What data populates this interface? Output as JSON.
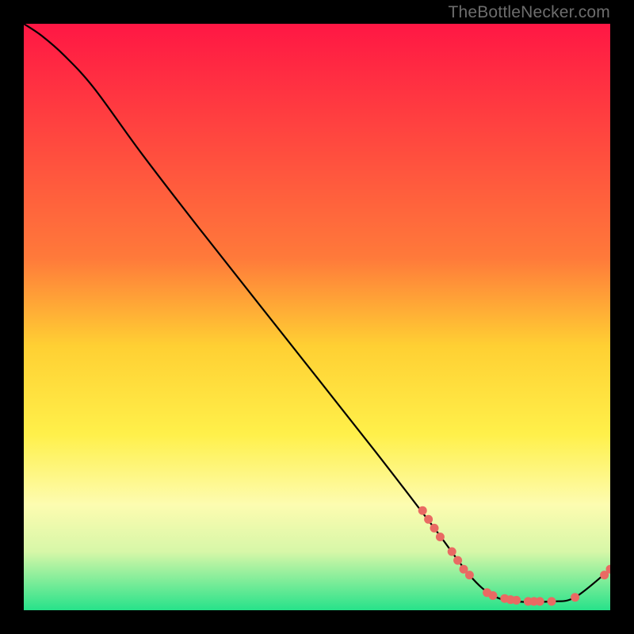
{
  "watermark": "TheBottleNecker.com",
  "chart_data": {
    "type": "line",
    "title": "",
    "xlabel": "",
    "ylabel": "",
    "xlim": [
      0,
      100
    ],
    "ylim": [
      0,
      100
    ],
    "gradient_stops": [
      {
        "offset": 0,
        "color": "#ff1744"
      },
      {
        "offset": 40,
        "color": "#ff7a3a"
      },
      {
        "offset": 55,
        "color": "#ffd033"
      },
      {
        "offset": 70,
        "color": "#fff04a"
      },
      {
        "offset": 82,
        "color": "#fdfcb0"
      },
      {
        "offset": 90,
        "color": "#d7f7a8"
      },
      {
        "offset": 100,
        "color": "#27e28a"
      }
    ],
    "curve": [
      {
        "x": 0,
        "y": 100
      },
      {
        "x": 3,
        "y": 98
      },
      {
        "x": 7,
        "y": 94.5
      },
      {
        "x": 12,
        "y": 89
      },
      {
        "x": 20,
        "y": 78
      },
      {
        "x": 30,
        "y": 65
      },
      {
        "x": 45,
        "y": 46
      },
      {
        "x": 60,
        "y": 27
      },
      {
        "x": 70,
        "y": 14
      },
      {
        "x": 76,
        "y": 6
      },
      {
        "x": 80,
        "y": 2.5
      },
      {
        "x": 84,
        "y": 1.5
      },
      {
        "x": 90,
        "y": 1.5
      },
      {
        "x": 94,
        "y": 2.2
      },
      {
        "x": 100,
        "y": 7
      }
    ],
    "markers": [
      {
        "x": 68,
        "y": 17
      },
      {
        "x": 69,
        "y": 15.5
      },
      {
        "x": 70,
        "y": 14
      },
      {
        "x": 71,
        "y": 12.5
      },
      {
        "x": 73,
        "y": 10
      },
      {
        "x": 74,
        "y": 8.5
      },
      {
        "x": 75,
        "y": 7
      },
      {
        "x": 76,
        "y": 6
      },
      {
        "x": 79,
        "y": 3
      },
      {
        "x": 80,
        "y": 2.5
      },
      {
        "x": 82,
        "y": 2
      },
      {
        "x": 83,
        "y": 1.8
      },
      {
        "x": 84,
        "y": 1.7
      },
      {
        "x": 86,
        "y": 1.5
      },
      {
        "x": 87,
        "y": 1.5
      },
      {
        "x": 88,
        "y": 1.5
      },
      {
        "x": 90,
        "y": 1.5
      },
      {
        "x": 94,
        "y": 2.2
      },
      {
        "x": 99,
        "y": 6
      },
      {
        "x": 100,
        "y": 7
      }
    ]
  }
}
